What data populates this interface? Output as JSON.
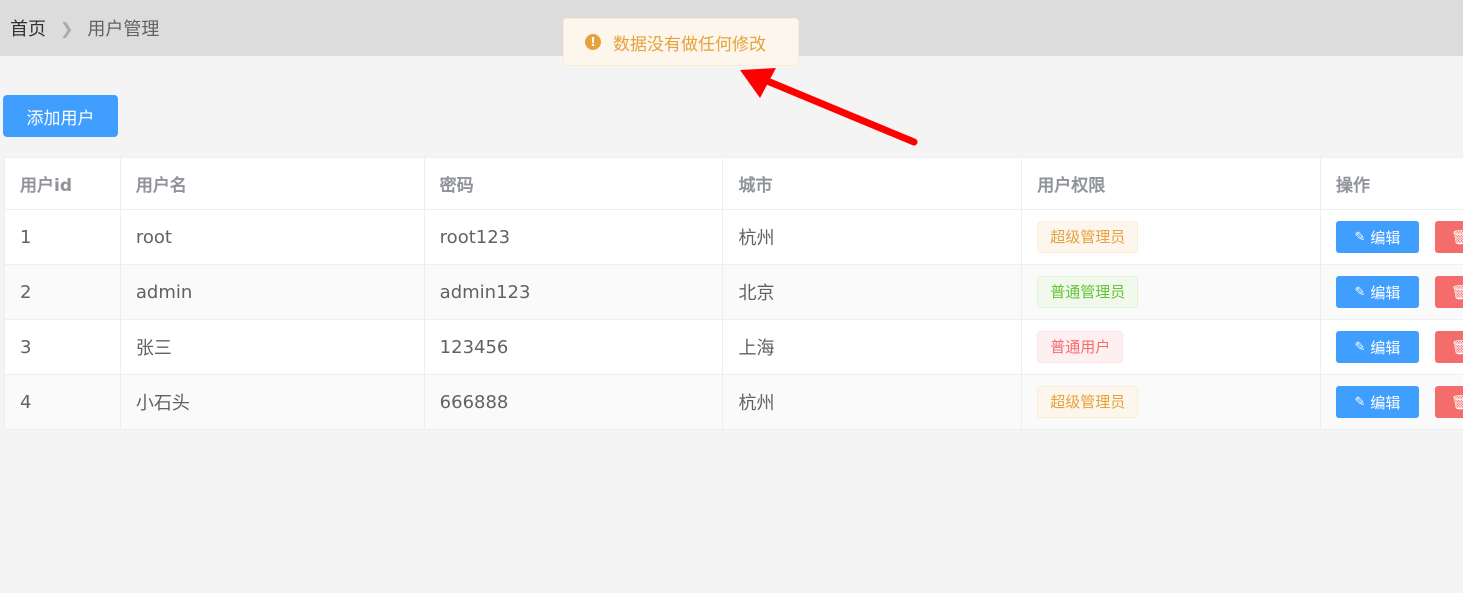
{
  "breadcrumb": {
    "home": "首页",
    "current": "用户管理"
  },
  "toast": {
    "message": "数据没有做任何修改",
    "type": "warning",
    "color": "#e6a23c"
  },
  "toolbar": {
    "add_label": "添加用户"
  },
  "colors": {
    "primary": "#409eff",
    "danger": "#f56c6c",
    "warning": "#e6a23c",
    "success": "#67c23a",
    "arrow": "#ff0000"
  },
  "table": {
    "headers": [
      "用户id",
      "用户名",
      "密码",
      "城市",
      "用户权限",
      "操作"
    ],
    "rows": [
      {
        "id": "1",
        "name": "root",
        "password": "root123",
        "city": "杭州",
        "role": "超级管理员",
        "role_type": "warning"
      },
      {
        "id": "2",
        "name": "admin",
        "password": "admin123",
        "city": "北京",
        "role": "普通管理员",
        "role_type": "success"
      },
      {
        "id": "3",
        "name": "张三",
        "password": "123456",
        "city": "上海",
        "role": "普通用户",
        "role_type": "danger"
      },
      {
        "id": "4",
        "name": "小石头",
        "password": "666888",
        "city": "杭州",
        "role": "超级管理员",
        "role_type": "warning"
      }
    ],
    "edit_label": "编辑"
  },
  "icons": {
    "breadcrumb_sep": "chevron-right-icon",
    "toast": "warning-circle-icon",
    "edit": "edit-icon",
    "delete": "trash-icon"
  }
}
